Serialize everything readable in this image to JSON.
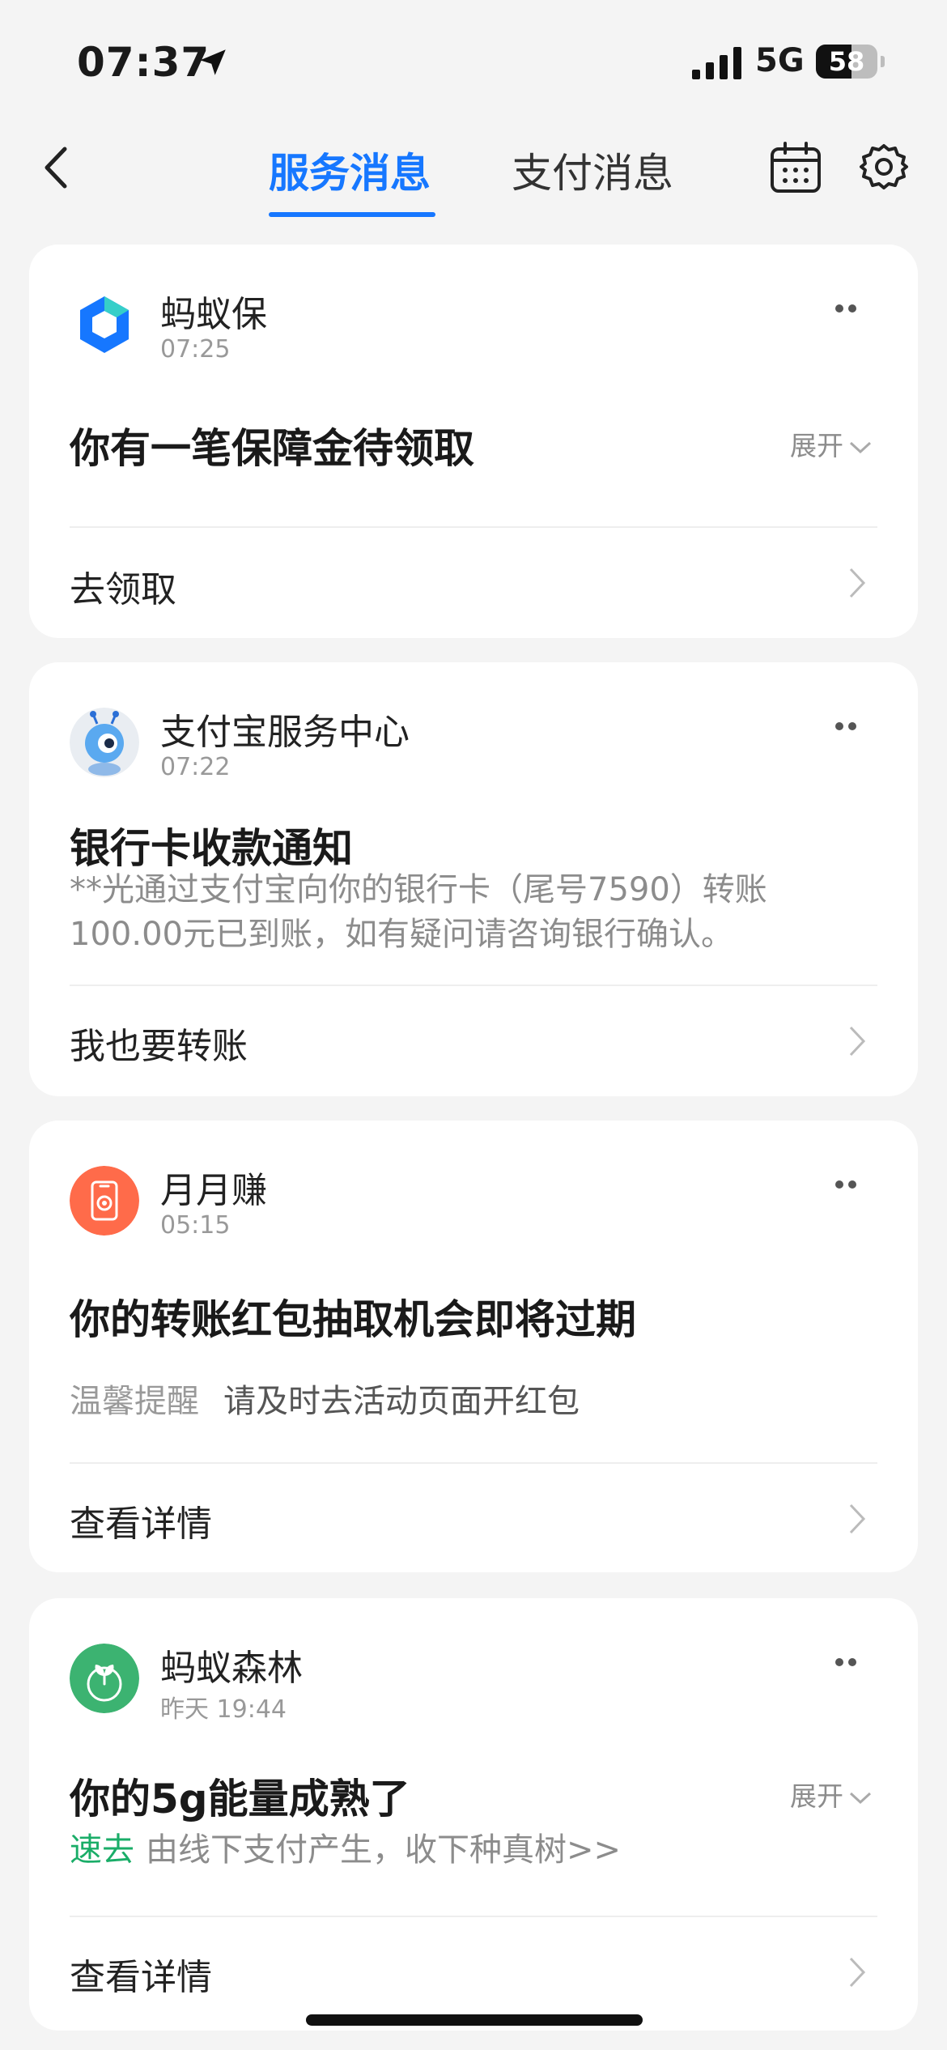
{
  "status_bar": {
    "time": "07:37",
    "network": "5G",
    "battery": "58",
    "battery_level": 0.58
  },
  "nav": {
    "tabs": [
      {
        "label": "服务消息",
        "active": true
      },
      {
        "label": "支付消息",
        "active": false
      }
    ],
    "icons": [
      "back-icon",
      "calendar-icon",
      "gear-icon"
    ]
  },
  "cards": [
    {
      "sender": "蚂蚁保",
      "time": "07:25",
      "avatar_icon": "ant-insurance-logo",
      "avatar_color": "#1677ff",
      "title": "你有一笔保障金待领取",
      "expand": "展开",
      "action": "去领取"
    },
    {
      "sender": "支付宝服务中心",
      "time": "07:22",
      "avatar_icon": "robot-ant-avatar",
      "title": "银行卡收款通知",
      "body": "**光通过支付宝向你的银行卡（尾号7590）转账100.00元已到账，如有疑问请咨询银行确认。",
      "action": "我也要转账"
    },
    {
      "sender": "月月赚",
      "time": "05:15",
      "avatar_icon": "phone-app-icon",
      "avatar_color": "#ff6b4a",
      "title": "你的转账红包抽取机会即将过期",
      "hint_label": "温馨提醒",
      "hint_text": "请及时去活动页面开红包",
      "action": "查看详情"
    },
    {
      "sender": "蚂蚁森林",
      "time": "昨天 19:44",
      "avatar_icon": "sprout-icon",
      "avatar_color": "#3cb371",
      "title": "你的5g能量成熟了",
      "expand": "展开",
      "highlight": "速去",
      "body": "由线下支付产生，收下种真树>>",
      "action": "查看详情"
    }
  ],
  "colors": {
    "accent": "#1677ff",
    "green": "#1aad68",
    "background": "#f4f4f4"
  }
}
